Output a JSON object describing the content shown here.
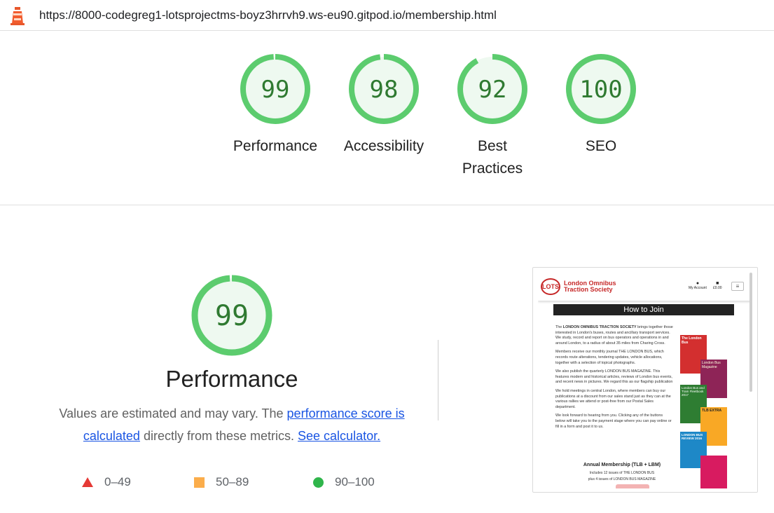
{
  "browser": {
    "url": "https://8000-codegreg1-lotsprojectms-boyz3hrrvh9.ws-eu90.gitpod.io/membership.html"
  },
  "summary_gauges": [
    {
      "score": "99",
      "label_line1": "Performance",
      "label_line2": "",
      "fraction": 0.99
    },
    {
      "score": "98",
      "label_line1": "Accessibility",
      "label_line2": "",
      "fraction": 0.98
    },
    {
      "score": "92",
      "label_line1": "Best",
      "label_line2": "Practices",
      "fraction": 0.92
    },
    {
      "score": "100",
      "label_line1": "SEO",
      "label_line2": "",
      "fraction": 1.0
    }
  ],
  "performance": {
    "score": "99",
    "fraction": 0.99,
    "title": "Performance",
    "desc_part1": "Values are estimated and may vary. The ",
    "link_performance_score": "performance score is calculated",
    "desc_part2": " directly from these metrics. ",
    "link_calculator": "See calculator."
  },
  "legend": {
    "fail": "0–49",
    "average": "50–89",
    "pass": "90–100"
  },
  "colors": {
    "pass_ring": "#5ccc6e",
    "pass_fill": "#eef9f0",
    "pass_text": "#2f7a31",
    "fail": "#e53935",
    "average": "#fbad4b",
    "pass": "#2fb54b",
    "link": "#1a55e3"
  },
  "icons": {
    "lighthouse": "lighthouse-icon",
    "fail": "triangle-icon",
    "average": "square-icon",
    "pass": "circle-icon"
  },
  "screenshot": {
    "logo": "LOTS",
    "site_name_line1": "London Omnibus",
    "site_name_line2": "Traction Society",
    "account_label": "My Account",
    "bag_label": "£0.00",
    "heading": "How to Join",
    "para1_prefix": "The ",
    "para1_bold": "LONDON OMNIBUS TRACTION SOCIETY",
    "para1_rest": " brings together those interested in London's buses, routes and ancillary transport services. We study, record and report on bus operators and operations in and around London, to a radius of about 35 miles from Charing Cross.",
    "para2": "Members receive our monthly journal THE LONDON BUS, which records route alterations, tendering updates, vehicle allocations, together with a selection of topical photographs.",
    "para3": "We also publish the quarterly LONDON BUS MAGAZINE. This features modern and historical articles, reviews of London bus events, and recent news in pictures. We regard this as our flagship publication",
    "para4": "We hold meetings in central London, where members can buy our publications at a discount from our sales stand just as they can at the various rallies we attend or post-free from our Postal Sales department.",
    "para5": "We look forward to hearing from you. Clicking any of the buttons below will take you to the payment stage where you can pay online or fill in a form and post it to us.",
    "membership_title": "Annual Membership (TLB + LBM)",
    "membership_line1": "Includes 12 issues of THE LONDON BUS",
    "membership_line2": "plus 4 issues of LONDON BUS MAGAZINE",
    "mag1_title": "The London Bus",
    "mag2_title": "London Bus Magazine",
    "mag3_title": "London Bus and Tram Fleetbook 2017",
    "mag4_title": "TLB EXTRA",
    "mag5_title": "LONDON BUS REVIEW 2016"
  }
}
